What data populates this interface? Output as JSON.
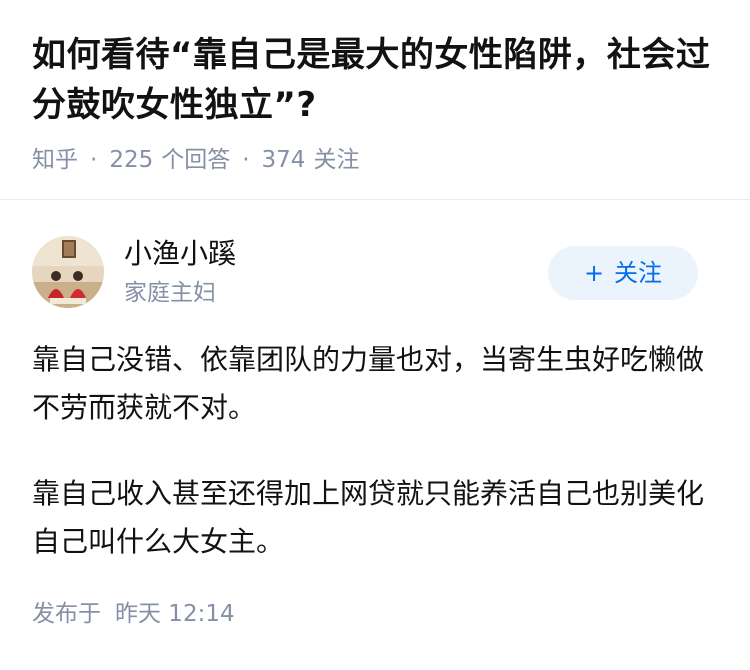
{
  "question": {
    "title": "如何看待“靠自己是最大的女性陷阱，社会过分鼓吹女性独立”?",
    "source": "知乎",
    "answer_count": "225",
    "answer_label": "个回答",
    "follower_count": "374",
    "follower_label": "关注"
  },
  "answer": {
    "author": {
      "name": "小渔小蹊",
      "bio": "家庭主妇"
    },
    "follow_button": {
      "icon": "+",
      "label": "关注"
    },
    "paragraphs": [
      "靠自己没错、依靠团队的力量也对，当寄生虫好吃懒做不劳而获就不对。",
      "靠自己收入甚至还得加上网贷就只能养活自己也别美化自己叫什么大女主。"
    ],
    "publish": {
      "label": "发布于",
      "time": "昨天 12:14"
    }
  },
  "colors": {
    "text_primary": "#121212",
    "text_secondary": "#8590a6",
    "accent_blue": "#056de8",
    "follow_bg": "#ebf3fd",
    "divider": "#ebebeb"
  }
}
